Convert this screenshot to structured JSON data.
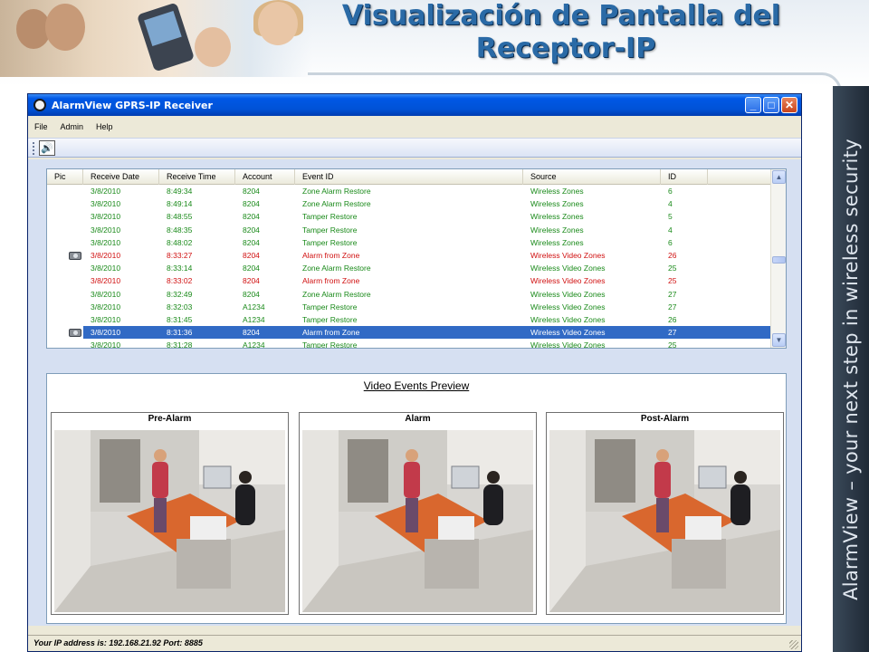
{
  "slide": {
    "title_line1": "Visualización de Pantalla del",
    "title_line2": "Receptor-IP",
    "side_text": "AlarmView – your next step in wireless security"
  },
  "window": {
    "title": "AlarmView GPRS-IP Receiver",
    "menu": [
      "File",
      "Admin",
      "Help"
    ],
    "toolbar_sound_icon": "speaker-icon",
    "status": "Your IP address is: 192.168.21.92  Port: 8885"
  },
  "grid": {
    "columns": [
      "Pic",
      "Receive Date",
      "Receive Time",
      "Account",
      "Event ID",
      "Source",
      "ID"
    ],
    "rows": [
      {
        "pic": false,
        "date": "3/8/2010",
        "time": "8:49:34",
        "account": "8204",
        "event": "Zone Alarm Restore",
        "source": "Wireless Zones",
        "id": "6",
        "color": "#1a8a1a",
        "selected": false
      },
      {
        "pic": false,
        "date": "3/8/2010",
        "time": "8:49:14",
        "account": "8204",
        "event": "Zone Alarm Restore",
        "source": "Wireless Zones",
        "id": "4",
        "color": "#1a8a1a",
        "selected": false
      },
      {
        "pic": false,
        "date": "3/8/2010",
        "time": "8:48:55",
        "account": "8204",
        "event": "Tamper Restore",
        "source": "Wireless Zones",
        "id": "5",
        "color": "#1a8a1a",
        "selected": false
      },
      {
        "pic": false,
        "date": "3/8/2010",
        "time": "8:48:35",
        "account": "8204",
        "event": "Tamper Restore",
        "source": "Wireless Zones",
        "id": "4",
        "color": "#1a8a1a",
        "selected": false
      },
      {
        "pic": false,
        "date": "3/8/2010",
        "time": "8:48:02",
        "account": "8204",
        "event": "Tamper Restore",
        "source": "Wireless Zones",
        "id": "6",
        "color": "#1a8a1a",
        "selected": false
      },
      {
        "pic": true,
        "date": "3/8/2010",
        "time": "8:33:27",
        "account": "8204",
        "event": "Alarm from Zone",
        "source": "Wireless Video Zones",
        "id": "26",
        "color": "#d01010",
        "selected": false
      },
      {
        "pic": false,
        "date": "3/8/2010",
        "time": "8:33:14",
        "account": "8204",
        "event": "Zone Alarm Restore",
        "source": "Wireless Video Zones",
        "id": "25",
        "color": "#1a8a1a",
        "selected": false
      },
      {
        "pic": false,
        "date": "3/8/2010",
        "time": "8:33:02",
        "account": "8204",
        "event": "Alarm from Zone",
        "source": "Wireless Video Zones",
        "id": "25",
        "color": "#d01010",
        "selected": false
      },
      {
        "pic": false,
        "date": "3/8/2010",
        "time": "8:32:49",
        "account": "8204",
        "event": "Zone Alarm Restore",
        "source": "Wireless Video Zones",
        "id": "27",
        "color": "#1a8a1a",
        "selected": false
      },
      {
        "pic": false,
        "date": "3/8/2010",
        "time": "8:32:03",
        "account": "A1234",
        "event": "Tamper Restore",
        "source": "Wireless Video Zones",
        "id": "27",
        "color": "#1a8a1a",
        "selected": false
      },
      {
        "pic": false,
        "date": "3/8/2010",
        "time": "8:31:45",
        "account": "A1234",
        "event": "Tamper Restore",
        "source": "Wireless Video Zones",
        "id": "26",
        "color": "#1a8a1a",
        "selected": false
      },
      {
        "pic": true,
        "date": "3/8/2010",
        "time": "8:31:36",
        "account": "8204",
        "event": "Alarm from Zone",
        "source": "Wireless Video Zones",
        "id": "27",
        "color": "#d01010",
        "selected": true
      },
      {
        "pic": false,
        "date": "3/8/2010",
        "time": "8:31:28",
        "account": "A1234",
        "event": "Tamper Restore",
        "source": "Wireless Video Zones",
        "id": "25",
        "color": "#1a8a1a",
        "selected": false
      }
    ]
  },
  "preview": {
    "title": "Video Events Preview",
    "frames": [
      {
        "label": "Pre-Alarm"
      },
      {
        "label": "Alarm"
      },
      {
        "label": "Post-Alarm"
      }
    ]
  }
}
